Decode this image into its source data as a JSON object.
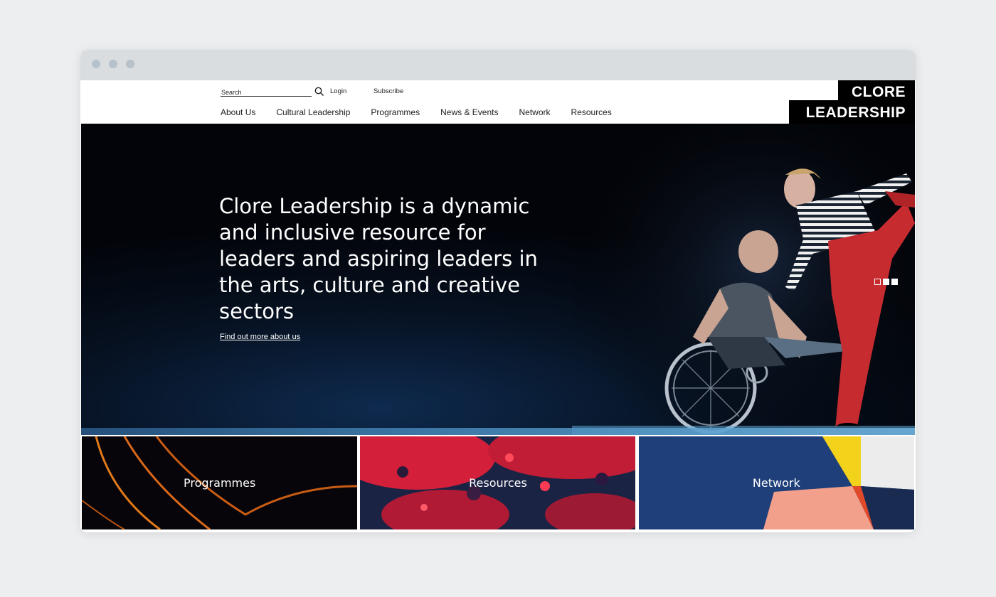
{
  "header": {
    "search_placeholder": "Search",
    "login": "Login",
    "subscribe": "Subscribe",
    "nav": [
      "About Us",
      "Cultural Leadership",
      "Programmes",
      "News & Events",
      "Network",
      "Resources"
    ],
    "logo_line1": "CLORE",
    "logo_line2": "LEADERSHIP"
  },
  "hero": {
    "title": "Clore Leadership is a dynamic and inclusive resource for leaders and aspiring leaders in the arts, culture and creative sectors",
    "link": "Find out more about us",
    "slides": 3,
    "active_slide": 1
  },
  "tiles": [
    {
      "label": "Programmes"
    },
    {
      "label": "Resources"
    },
    {
      "label": "Network"
    }
  ],
  "colors": {
    "hero_dark": "#06101f",
    "logo_bg": "#000000",
    "accent_red": "#e0203a",
    "accent_blue": "#1f3f7a",
    "accent_orange": "#e07a1a",
    "chrome_bg": "#d9dde0"
  }
}
